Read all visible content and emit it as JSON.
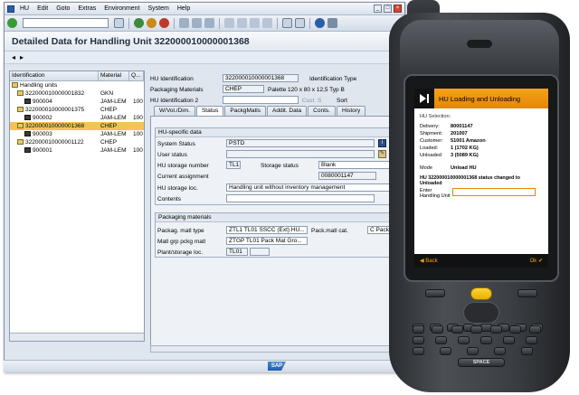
{
  "menu": [
    "HU",
    "Edit",
    "Goto",
    "Extras",
    "Environment",
    "System",
    "Help"
  ],
  "window_controls": [
    "minimize",
    "maximize",
    "close"
  ],
  "page_title": "Detailed Data for Handling Unit 322000010000001368",
  "tree": {
    "headers": [
      "Identification",
      "Material",
      "Q..."
    ],
    "root": "Handling units",
    "rows": [
      {
        "id": "322000010000001832",
        "material": "GKN",
        "qty": "",
        "level": 1,
        "kind": "hu",
        "selected": false
      },
      {
        "id": "900004",
        "material": "JAM-LEM",
        "qty": "100",
        "level": 2,
        "kind": "mat",
        "selected": false
      },
      {
        "id": "322000010000001375",
        "material": "CHEP",
        "qty": "",
        "level": 1,
        "kind": "hu",
        "selected": false
      },
      {
        "id": "900002",
        "material": "JAM-LEM",
        "qty": "100",
        "level": 2,
        "kind": "mat",
        "selected": false
      },
      {
        "id": "322000010000001368",
        "material": "CHEP",
        "qty": "",
        "level": 1,
        "kind": "hu",
        "selected": true
      },
      {
        "id": "900003",
        "material": "JAM-LEM",
        "qty": "100",
        "level": 2,
        "kind": "mat",
        "selected": false
      },
      {
        "id": "322000010000001122",
        "material": "CHEP",
        "qty": "",
        "level": 1,
        "kind": "hu",
        "selected": false
      },
      {
        "id": "900001",
        "material": "JAM-LEM",
        "qty": "100",
        "level": 2,
        "kind": "mat",
        "selected": false
      }
    ]
  },
  "header": {
    "hu_identification_label": "HU Identification",
    "hu_identification_value": "322000010000001368",
    "identification_type_label": "Identification Type",
    "packaging_materials_label": "Packaging Materials",
    "packaging_materials_value": "CHEP",
    "packaging_materials_desc": "Palette 120 x 80 x 12,5 Typ B",
    "hu_identification2_label": "HU Identification 2",
    "cust_s_label": "Cust. S",
    "sort_label": "Sort"
  },
  "tabs": [
    {
      "label": "W/Vol./Dim.",
      "active": false
    },
    {
      "label": "Status",
      "active": true
    },
    {
      "label": "PackgMatls",
      "active": false
    },
    {
      "label": "Addit. Data",
      "active": false
    },
    {
      "label": "Conts.",
      "active": false
    },
    {
      "label": "History",
      "active": false
    }
  ],
  "hu_specific": {
    "group_title": "HU-specific data",
    "system_status_label": "System Status",
    "system_status_value": "PSTD",
    "user_status_label": "User status",
    "hu_storage_number_label": "HU storage number",
    "hu_storage_number_value": "TL1",
    "storage_status_label": "Storage status",
    "storage_status_value": "Blank",
    "current_assignment_label": "Current assignment",
    "current_assignment_value": "0080001147",
    "hu_storage_loc_label": "HU storage loc.",
    "hu_storage_loc_value": "Handling unit without inventory management",
    "contents_label": "Contents"
  },
  "packaging": {
    "group_title": "Packaging materials",
    "packag_matl_type_label": "Packag. matl type",
    "packag_matl_type_value": "ZTL1 TL01 SSCC (Ext) HU...",
    "pack_matl_cat_label": "Pack.matl cat.",
    "pack_matl_cat_value": "C Packa",
    "matl_grp_label": "Matl grp pckg matl",
    "matl_grp_value": "ZTGP TL01 Pack Mat Gro...",
    "plant_label": "Plant/storage loc.",
    "plant_value": "TL01"
  },
  "statusbar": {
    "logo": "SAP"
  },
  "device": {
    "screen_title": "HU Loading and Unloading",
    "section": "HU Selection:",
    "fields": [
      {
        "k": "Delivery:",
        "v": "80001147"
      },
      {
        "k": "Shipment:",
        "v": "201007"
      },
      {
        "k": "Customer:",
        "v": "51001 Amazon"
      },
      {
        "k": "Loaded:",
        "v": "1 (1702  KG)"
      },
      {
        "k": "Unloaded",
        "v": "3 (5089  KG)"
      }
    ],
    "mode_label": "Mode",
    "mode_value": "Unload HU",
    "message": "HU 322000010000001368 status changed to Unloaded",
    "enter_label": "Enter Handling Unit",
    "back": "Back",
    "ok": "Ok",
    "space_key": "SPACE",
    "accent": "#f6a21a"
  }
}
